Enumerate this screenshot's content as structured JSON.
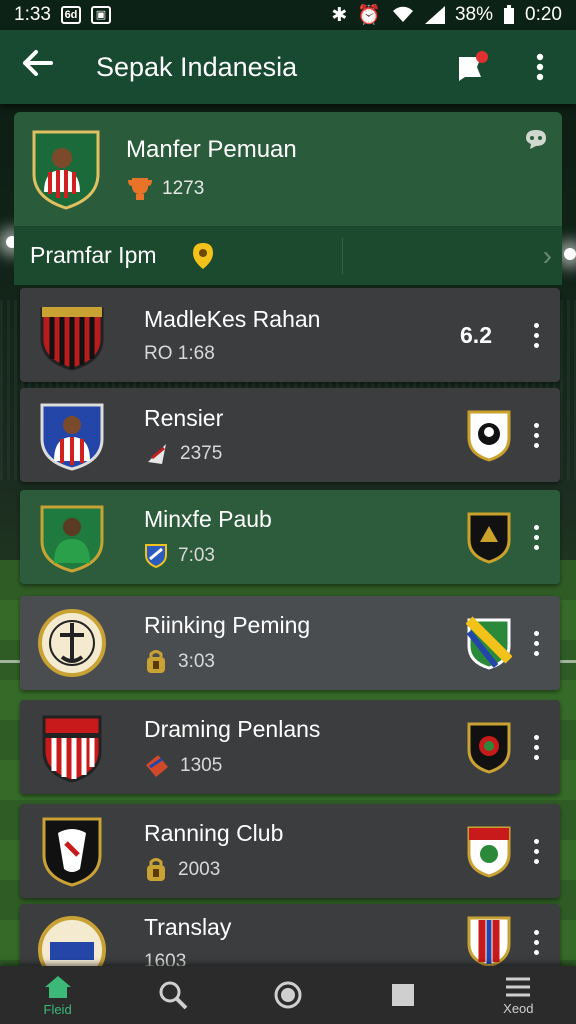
{
  "status_bar": {
    "time": "1:33",
    "battery": "38%",
    "clock": "0:20"
  },
  "app_bar": {
    "title": "Sepak Indanesia"
  },
  "header": {
    "name": "Manfer Pemuan",
    "meta": "1273"
  },
  "section": {
    "label": "Pramfar Ipm"
  },
  "rows": [
    {
      "name": "MadleKes Rahan",
      "meta": "RO 1:68",
      "score": "6.2"
    },
    {
      "name": "Rensier",
      "meta": "2375",
      "score": ""
    },
    {
      "name": "Minxfe Paub",
      "meta": "7:03",
      "score": ""
    },
    {
      "name": "Riinking Peming",
      "meta": "3:03",
      "score": ""
    },
    {
      "name": "Draming Penlans",
      "meta": "1305",
      "score": ""
    },
    {
      "name": "Ranning Club",
      "meta": "2003",
      "score": ""
    },
    {
      "name": "Translay",
      "meta": "1603",
      "score": ""
    }
  ],
  "bottom_nav": [
    {
      "label": "Fleid",
      "icon": "home-icon"
    },
    {
      "label": "",
      "icon": "search-icon"
    },
    {
      "label": "",
      "icon": "record-icon"
    },
    {
      "label": "",
      "icon": "square-icon"
    },
    {
      "label": "Xeod",
      "icon": "menu-icon"
    }
  ],
  "colors": {
    "accent": "#3cb878",
    "appbar": "#174a30",
    "active_row": "#2c5c3c"
  }
}
